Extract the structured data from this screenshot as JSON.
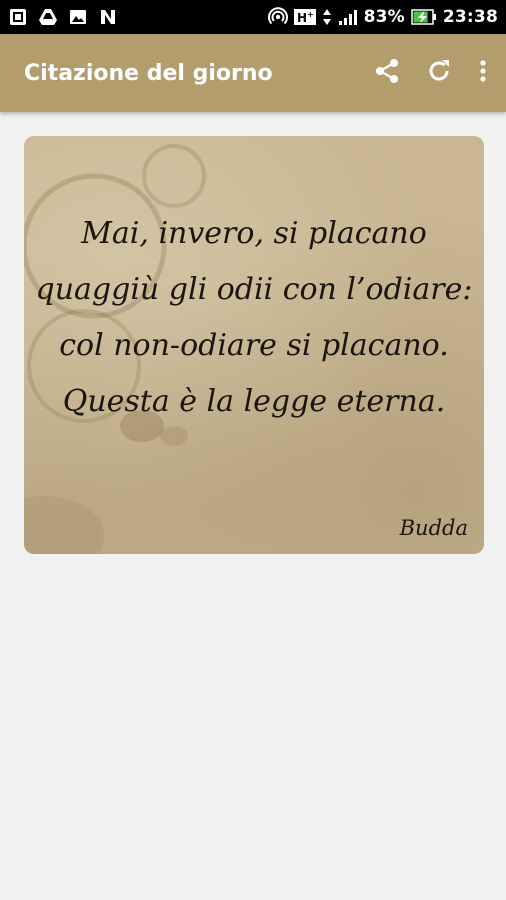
{
  "status_bar": {
    "icons_left": [
      "photo-app-icon",
      "drive-icon",
      "gallery-icon",
      "n-app-icon"
    ],
    "icons_right": [
      "hotspot-icon",
      "hplus-network-icon",
      "data-arrows-icon",
      "signal-icon"
    ],
    "battery_percent": "83%",
    "battery_level": 0.83,
    "time": "23:38"
  },
  "app_bar": {
    "title": "Citazione del giorno",
    "actions": [
      "share-icon",
      "refresh-icon",
      "overflow-menu-icon"
    ],
    "color": "#b49d6d"
  },
  "quote_card": {
    "text": "Mai, invero, si placano\nquaggiù gli odii con l’odiare:\ncol non-odiare si placano.\nQuesta è la legge eterna.",
    "author": "Budda",
    "background_color": "#c9b793"
  }
}
